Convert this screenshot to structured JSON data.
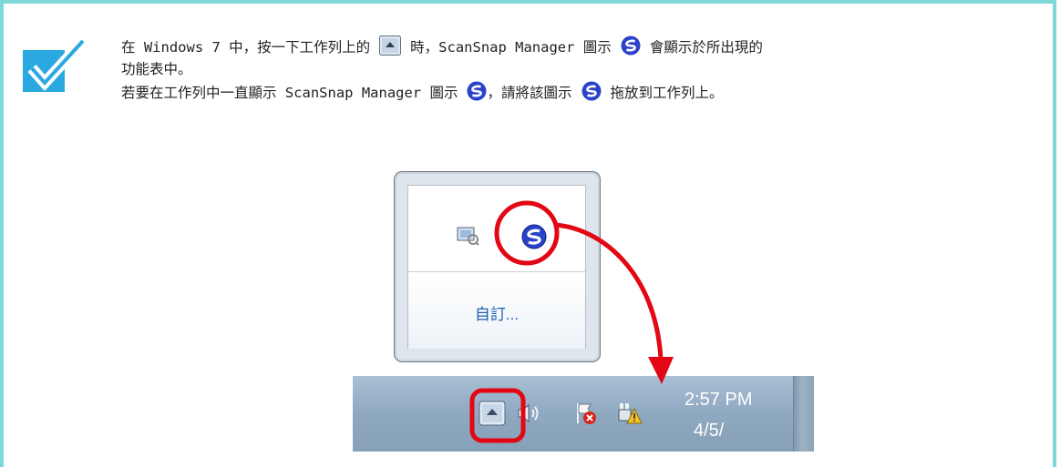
{
  "note": {
    "line1_a": "在 Windows 7 中，按一下工作列上的",
    "line1_b": "時，ScanSnap Manager 圖示",
    "line1_c": "會顯示於所出現的",
    "line2": "功能表中。",
    "line3_a": "若要在工作列中一直顯示 ScanSnap Manager 圖示",
    "line3_b": "，請將該圖示",
    "line3_c": "拖放到工作列上。"
  },
  "popup": {
    "customize_label": "自訂..."
  },
  "taskbar": {
    "time": "2:57 PM",
    "date": "4/5/"
  },
  "colors": {
    "frame": "#7fd8d8",
    "check": "#29a9e0",
    "scansnap_blue": "#2a43c8",
    "highlight_red": "#e30613",
    "link": "#1d5fb0"
  },
  "icons": [
    "checkmark-icon",
    "show-hidden-icons-icon",
    "scansnap-manager-icon",
    "network-icon",
    "volume-icon",
    "action-center-flag-icon",
    "power-warning-icon"
  ]
}
